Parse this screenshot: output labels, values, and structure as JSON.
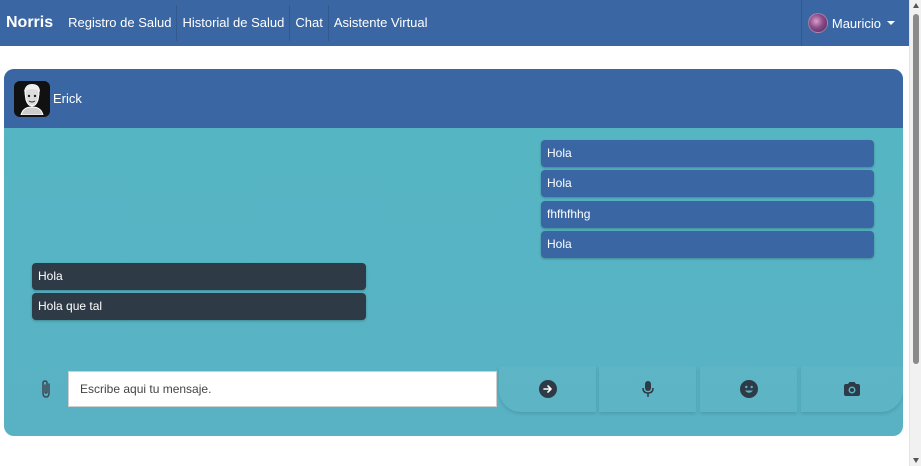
{
  "navbar": {
    "brand": "Norris",
    "links": [
      "Registro de Salud",
      "Historial de Salud",
      "Chat",
      "Asistente Virtual"
    ],
    "user_name": "Mauricio",
    "color": "#3a67a3"
  },
  "chat": {
    "contact_name": "Erick",
    "outgoing_color": "#3a67a3",
    "incoming_color": "#2e3a46",
    "messages": [
      {
        "direction": "out",
        "text": "Hola"
      },
      {
        "direction": "out",
        "text": "Hola"
      },
      {
        "direction": "out",
        "text": "fhfhfhhg"
      },
      {
        "direction": "out",
        "text": "Hola"
      },
      {
        "direction": "in",
        "text": "Hola"
      },
      {
        "direction": "in",
        "text": "Hola que tal"
      }
    ],
    "input_placeholder": "Escribe aqui tu mensaje.",
    "icons": [
      "paperclip-icon",
      "send-arrow-icon",
      "microphone-icon",
      "emoji-icon",
      "camera-icon"
    ]
  }
}
